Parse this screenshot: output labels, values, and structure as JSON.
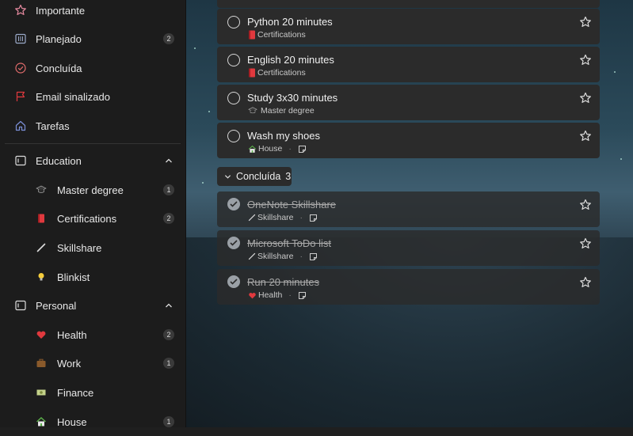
{
  "sidebar": {
    "items": [
      {
        "label": "Importante",
        "icon": "star-icon"
      },
      {
        "label": "Planejado",
        "icon": "calendar-icon",
        "badge": "2"
      },
      {
        "label": "Concluída",
        "icon": "check-circle-icon"
      },
      {
        "label": "Email sinalizado",
        "icon": "flag-icon"
      },
      {
        "label": "Tarefas",
        "icon": "home-icon"
      }
    ],
    "groups": [
      {
        "label": "Education",
        "icon": "group-icon",
        "lists": [
          {
            "label": "Master degree",
            "icon": "graduation-cap-icon",
            "badge": "1"
          },
          {
            "label": "Certifications",
            "icon": "red-book-icon",
            "badge": "2"
          },
          {
            "label": "Skillshare",
            "icon": "pencil-icon"
          },
          {
            "label": "Blinkist",
            "icon": "lightbulb-icon"
          }
        ]
      },
      {
        "label": "Personal",
        "icon": "group-icon",
        "lists": [
          {
            "label": "Health",
            "icon": "heart-icon",
            "badge": "2"
          },
          {
            "label": "Work",
            "icon": "briefcase-icon",
            "badge": "1"
          },
          {
            "label": "Finance",
            "icon": "money-icon"
          },
          {
            "label": "House",
            "icon": "house-icon",
            "badge": "1"
          }
        ]
      }
    ]
  },
  "tasks": [
    {
      "title": "Python 20 minutes",
      "list": "Certifications",
      "list_icon": "red-book-icon"
    },
    {
      "title": "English 20 minutes",
      "list": "Certifications",
      "list_icon": "red-book-icon"
    },
    {
      "title": "Study 3x30 minutes",
      "list": "Master degree",
      "list_icon": "graduation-cap-icon"
    },
    {
      "title": "Wash my shoes",
      "list": "House",
      "list_icon": "house-icon",
      "has_note": true
    }
  ],
  "completed_section": {
    "label": "Concluída",
    "count": "3"
  },
  "completed": [
    {
      "title": "OneNote Skillshare",
      "list": "Skillshare",
      "list_icon": "pencil-icon"
    },
    {
      "title": "Microsoft ToDo list",
      "list": "Skillshare",
      "list_icon": "pencil-icon"
    },
    {
      "title": "Run 20 minutes",
      "list": "Health",
      "list_icon": "heart-icon"
    }
  ],
  "colors": {
    "accent_red": "#e0393e",
    "accent_blue": "#6ea0ff",
    "card": "#2b2b2b",
    "sidebar": "#1c1c1c"
  }
}
